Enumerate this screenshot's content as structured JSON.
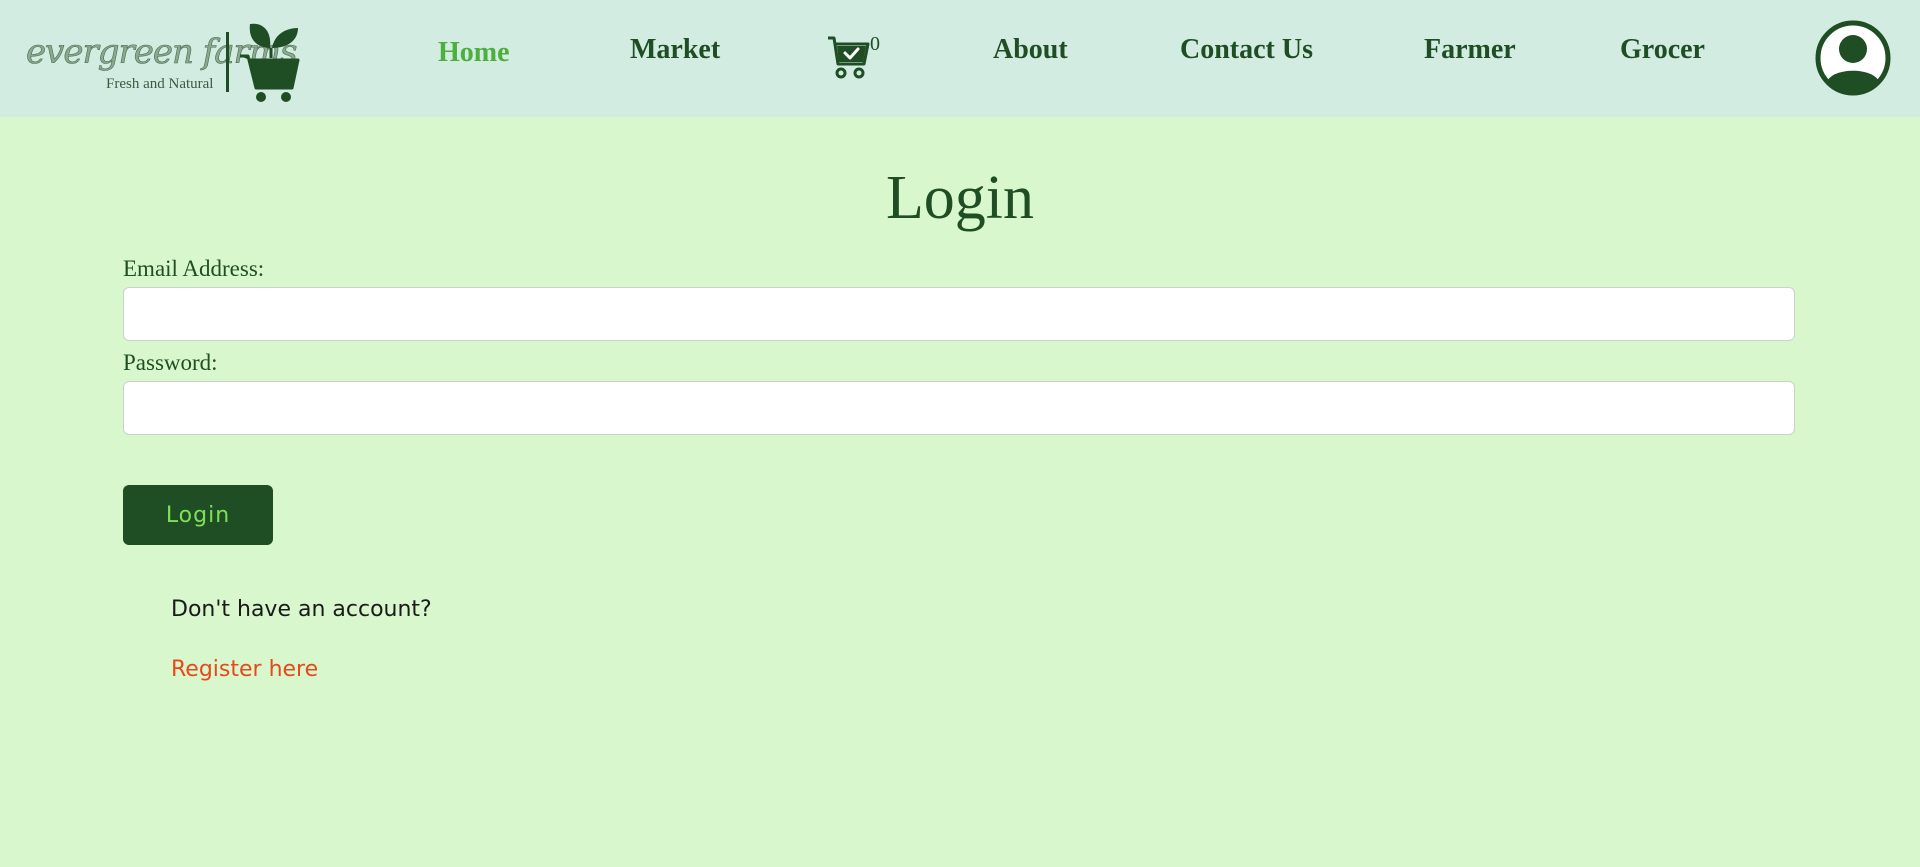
{
  "brand": {
    "name": "evergreen farms",
    "tagline": "Fresh and Natural",
    "logo_icon": "cart-with-leaves-icon",
    "color": "#1f4d24"
  },
  "nav": {
    "items": [
      {
        "label": "Home",
        "active": true
      },
      {
        "label": "Market"
      },
      {
        "label": "About"
      },
      {
        "label": "Contact Us"
      },
      {
        "label": "Farmer"
      },
      {
        "label": "Grocer"
      }
    ],
    "cart": {
      "icon": "cart-check-icon",
      "count": "0"
    },
    "profile_icon": "user-circle-icon",
    "active_color": "#4caf3e"
  },
  "login": {
    "title": "Login",
    "email_label": "Email Address:",
    "email_value": "",
    "password_label": "Password:",
    "password_value": "",
    "submit_label": "Login",
    "register_prompt": "Don't have an account?",
    "register_link": "Register here",
    "link_color": "#e8481a"
  },
  "colors": {
    "background": "#d9f7cd",
    "header": "#d2ece1",
    "button_bg": "#1f4d24",
    "button_text": "#7ee05a"
  }
}
